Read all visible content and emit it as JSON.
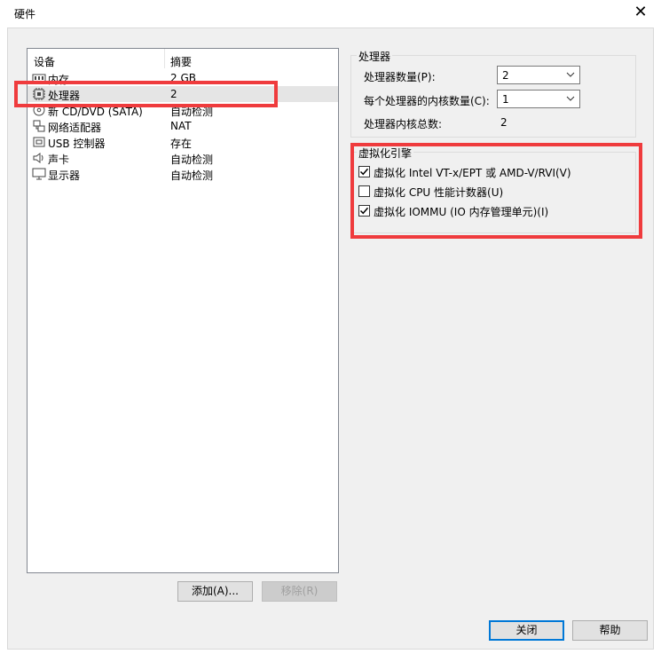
{
  "window": {
    "title": "硬件"
  },
  "device_list": {
    "headers": {
      "device": "设备",
      "summary": "摘要"
    },
    "rows": [
      {
        "icon": "memory-icon",
        "name": "内存",
        "summary": "2 GB"
      },
      {
        "icon": "processor-icon",
        "name": "处理器",
        "summary": "2"
      },
      {
        "icon": "cd-dvd-icon",
        "name": "新 CD/DVD (SATA)",
        "summary": "自动检测"
      },
      {
        "icon": "network-adapter-icon",
        "name": "网络适配器",
        "summary": "NAT"
      },
      {
        "icon": "usb-icon",
        "name": "USB 控制器",
        "summary": "存在"
      },
      {
        "icon": "sound-card-icon",
        "name": "声卡",
        "summary": "自动检测"
      },
      {
        "icon": "display-icon",
        "name": "显示器",
        "summary": "自动检测"
      }
    ],
    "selected_index": 1,
    "add_label": "添加(A)...",
    "remove_label": "移除(R)"
  },
  "processor": {
    "group_title": "处理器",
    "count_label": "处理器数量(P):",
    "count_value": "2",
    "cores_label": "每个处理器的内核数量(C):",
    "cores_value": "1",
    "total_label": "处理器内核总数:",
    "total_value": "2"
  },
  "virtualization": {
    "group_title": "虚拟化引擎",
    "options": [
      {
        "label": "虚拟化 Intel VT-x/EPT 或 AMD-V/RVI(V)",
        "checked": true
      },
      {
        "label": "虚拟化 CPU 性能计数器(U)",
        "checked": false
      },
      {
        "label": "虚拟化 IOMMU (IO 内存管理单元)(I)",
        "checked": true
      }
    ]
  },
  "footer": {
    "close_label": "关闭",
    "help_label": "帮助"
  },
  "colors": {
    "highlight": "#ef3b3d",
    "selection": "#e5e5e5",
    "check": "#000000"
  }
}
